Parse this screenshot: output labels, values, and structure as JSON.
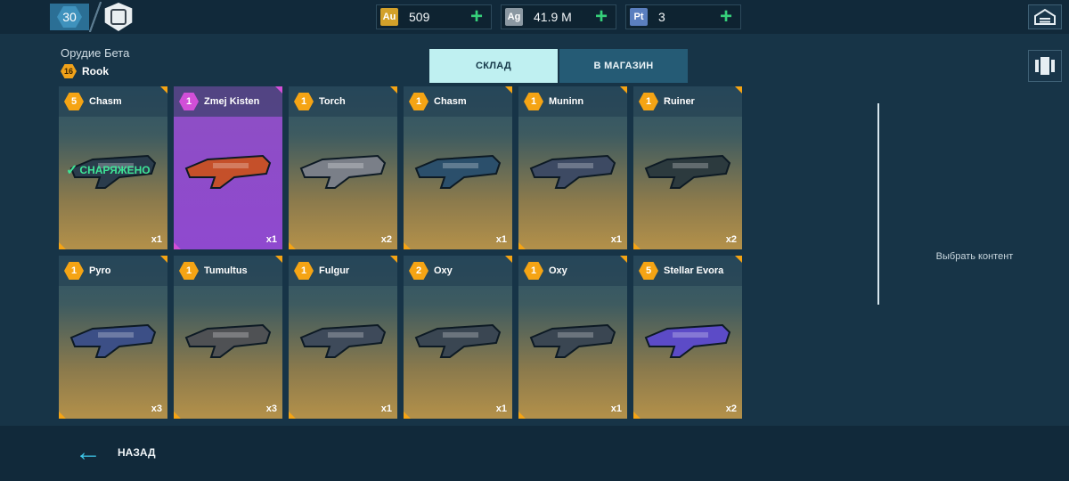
{
  "topbar": {
    "level": "30",
    "currencies": [
      {
        "icon": "Au",
        "value": "509",
        "color": "#d3a12a"
      },
      {
        "icon": "Ag",
        "value": "41.9 M",
        "color": "#8b98a2"
      },
      {
        "icon": "Pt",
        "value": "3",
        "color": "#5b7fbf"
      }
    ]
  },
  "weapon": {
    "title": "Орудие Бета",
    "robot_level": "16",
    "robot_name": "Rook"
  },
  "tabs": {
    "warehouse": "СКЛАД",
    "shop": "В МАГАЗИН"
  },
  "colors": {
    "rarity_common": "#f5a414",
    "rarity_epic": "#d24fd8",
    "equipped": "#3ee597",
    "plus": "#36d07a"
  },
  "items": [
    {
      "level": "5",
      "name": "Chasm",
      "qty": "x1",
      "equipped": "СНАРЯЖЕНО",
      "rarity": "common",
      "icon": "chasm-weapon-icon"
    },
    {
      "level": "1",
      "name": "Zmej Kisten",
      "qty": "x1",
      "rarity": "epic",
      "icon": "zmej-kisten-weapon-icon"
    },
    {
      "level": "1",
      "name": "Torch",
      "qty": "x2",
      "rarity": "common",
      "icon": "torch-weapon-icon"
    },
    {
      "level": "1",
      "name": "Chasm",
      "qty": "x1",
      "rarity": "common",
      "icon": "chasm-weapon-icon"
    },
    {
      "level": "1",
      "name": "Muninn",
      "qty": "x1",
      "rarity": "common",
      "icon": "muninn-weapon-icon"
    },
    {
      "level": "1",
      "name": "Ruiner",
      "qty": "x2",
      "rarity": "common",
      "icon": "ruiner-weapon-icon"
    },
    {
      "level": "1",
      "name": "Pyro",
      "qty": "x3",
      "rarity": "common",
      "icon": "pyro-weapon-icon"
    },
    {
      "level": "1",
      "name": "Tumultus",
      "qty": "x3",
      "rarity": "common",
      "icon": "tumultus-weapon-icon"
    },
    {
      "level": "1",
      "name": "Fulgur",
      "qty": "x1",
      "rarity": "common",
      "icon": "fulgur-weapon-icon"
    },
    {
      "level": "2",
      "name": "Oxy",
      "qty": "x1",
      "rarity": "common",
      "icon": "oxy-weapon-icon"
    },
    {
      "level": "1",
      "name": "Oxy",
      "qty": "x1",
      "rarity": "common",
      "icon": "oxy-weapon-icon"
    },
    {
      "level": "5",
      "name": "Stellar Evora",
      "qty": "x2",
      "rarity": "common",
      "icon": "stellar-evora-weapon-icon"
    }
  ],
  "side_panel": {
    "select_content": "Выбрать контент"
  },
  "footer": {
    "back_label": "НАЗАД"
  }
}
